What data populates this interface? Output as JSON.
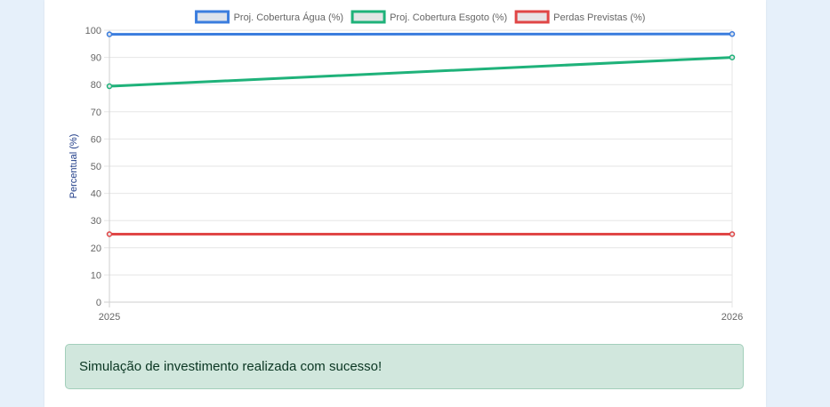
{
  "chart_data": {
    "type": "line",
    "categories": [
      "2025",
      "2026"
    ],
    "series": [
      {
        "name": "Proj. Cobertura Água (%)",
        "values": [
          98.5,
          98.6
        ],
        "color": "#3b7dde",
        "fill": "#dde3ec"
      },
      {
        "name": "Proj. Cobertura Esgoto (%)",
        "values": [
          79.4,
          90.0
        ],
        "color": "#1fb27a",
        "fill": "#e3e6e6"
      },
      {
        "name": "Perdas Previstas (%)",
        "values": [
          25.0,
          25.0
        ],
        "color": "#e04646",
        "fill": "#e8e4e6"
      }
    ],
    "ylabel": "Percentual (%)",
    "ylim": [
      0,
      100
    ],
    "yticks": [
      0,
      10,
      20,
      30,
      40,
      50,
      60,
      70,
      80,
      90,
      100
    ],
    "grid": true,
    "legend": "top-center"
  },
  "alert": {
    "message": "Simulação de investimento realizada com sucesso!",
    "color": "#d1e7dd"
  }
}
